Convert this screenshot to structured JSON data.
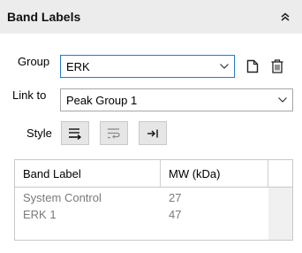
{
  "header": {
    "title": "Band Labels",
    "collapse_icon": "double-chevron-up-icon"
  },
  "group": {
    "label": "Group",
    "value": "ERK",
    "new_icon": "new-document-icon",
    "delete_icon": "trash-icon"
  },
  "link": {
    "label": "Link to",
    "value": "Peak Group 1"
  },
  "style": {
    "label": "Style",
    "buttons": [
      "align-bottom-arrow-icon",
      "wrap-text-icon",
      "arrow-to-right-icon"
    ]
  },
  "table": {
    "columns": [
      "Band Label",
      "MW (kDa)"
    ],
    "rows": [
      {
        "label": "System Control",
        "mw": "27"
      },
      {
        "label": "ERK 1",
        "mw": "47"
      }
    ]
  },
  "colors": {
    "accent": "#2a78c5",
    "header_bg": "#ececec",
    "row_text": "#7a7a7a"
  }
}
